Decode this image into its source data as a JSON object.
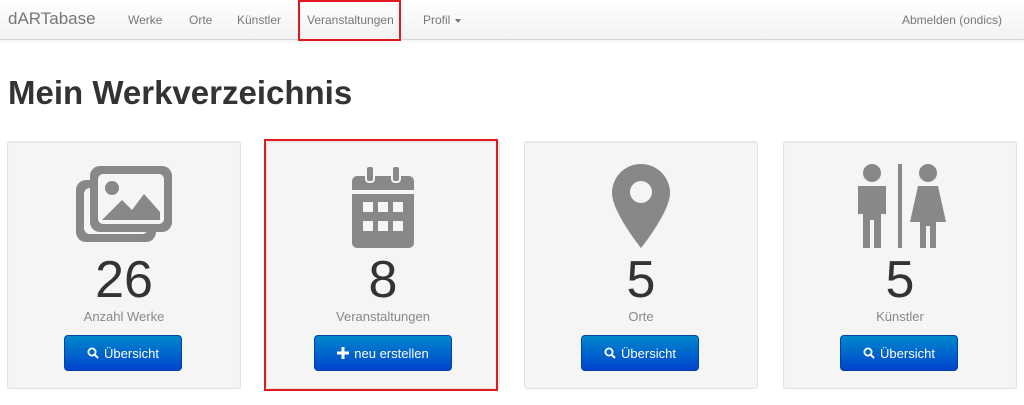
{
  "navbar": {
    "brand": "dARTabase",
    "items": [
      {
        "label": "Werke"
      },
      {
        "label": "Orte"
      },
      {
        "label": "Künstler"
      },
      {
        "label": "Veranstaltungen"
      },
      {
        "label": "Profil"
      }
    ],
    "logout": "Abmelden (ondics)"
  },
  "page": {
    "title": "Mein Werkverzeichnis"
  },
  "cards": [
    {
      "icon": "images-icon",
      "count": "26",
      "label": "Anzahl Werke",
      "button": "Übersicht",
      "button_icon": "search-icon"
    },
    {
      "icon": "calendar-icon",
      "count": "8",
      "label": "Veranstaltungen",
      "button": "neu erstellen",
      "button_icon": "plus-icon"
    },
    {
      "icon": "map-marker-icon",
      "count": "5",
      "label": "Orte",
      "button": "Übersicht",
      "button_icon": "search-icon"
    },
    {
      "icon": "people-icon",
      "count": "5",
      "label": "Künstler",
      "button": "Übersicht",
      "button_icon": "search-icon"
    }
  ],
  "colors": {
    "icon_gray": "#888888",
    "button_blue": "#0066cc",
    "highlight_red": "#e0191e",
    "card_bg": "#f5f5f5"
  }
}
